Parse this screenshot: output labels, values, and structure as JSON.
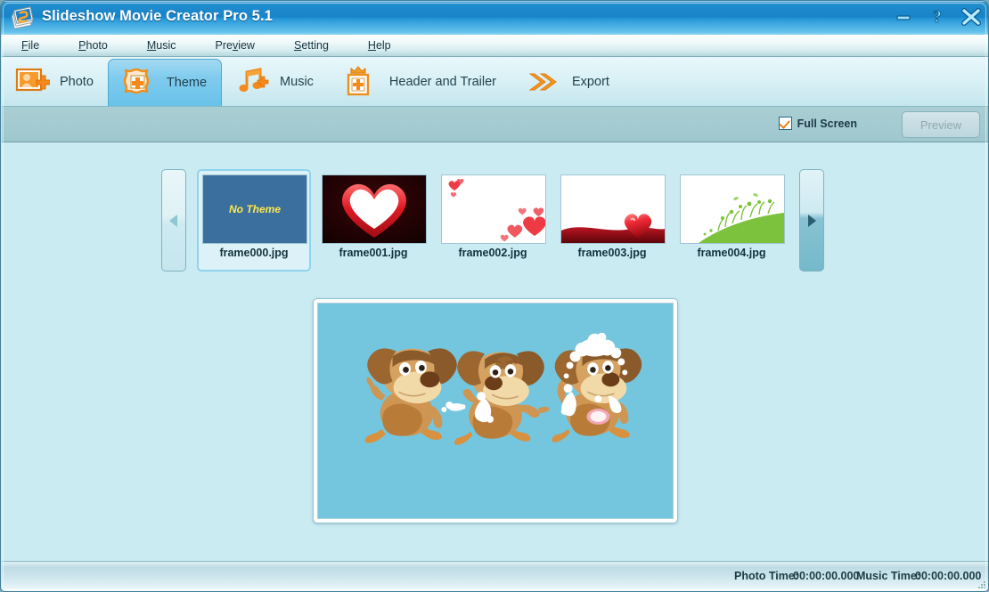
{
  "window": {
    "title": "Slideshow Movie Creator Pro 5.1",
    "app_icon": "slideshow-app-icon",
    "controls": [
      {
        "name": "minimize",
        "glyph": "minimize-icon"
      },
      {
        "name": "help",
        "glyph": "help-question-icon"
      },
      {
        "name": "close",
        "glyph": "close-x-icon"
      }
    ]
  },
  "menubar": {
    "items": [
      {
        "label": "File",
        "pre": "",
        "key": "F",
        "post": "ile"
      },
      {
        "label": "Photo",
        "pre": "",
        "key": "P",
        "post": "hoto"
      },
      {
        "label": "Music",
        "pre": "",
        "key": "M",
        "post": "usic"
      },
      {
        "label": "Preview",
        "pre": "Pre",
        "key": "v",
        "post": "iew"
      },
      {
        "label": "Setting",
        "pre": "",
        "key": "S",
        "post": "etting"
      },
      {
        "label": "Help",
        "pre": "",
        "key": "H",
        "post": "elp"
      }
    ]
  },
  "toolbar": {
    "items": [
      {
        "label": "Photo",
        "icon": "photo-add-icon",
        "selected": false
      },
      {
        "label": "Theme",
        "icon": "theme-frame-icon",
        "selected": true
      },
      {
        "label": "Music",
        "icon": "music-add-icon",
        "selected": false
      },
      {
        "label": "Header and Trailer",
        "icon": "header-crown-icon",
        "selected": false
      },
      {
        "label": "Export",
        "icon": "export-chevrons-icon",
        "selected": false
      }
    ]
  },
  "options": {
    "fullscreen_label": "Full Screen",
    "fullscreen_checked": true,
    "preview_button": "Preview",
    "preview_enabled": false
  },
  "themes": {
    "prev_arrow": "scroll-left-icon",
    "next_arrow": "scroll-right-icon",
    "selected_index": 0,
    "items": [
      {
        "caption": "frame000.jpg",
        "kind": "no-theme",
        "text": "No Theme"
      },
      {
        "caption": "frame001.jpg",
        "kind": "heart-outline"
      },
      {
        "caption": "frame002.jpg",
        "kind": "hearts-corner"
      },
      {
        "caption": "frame003.jpg",
        "kind": "heart-wave"
      },
      {
        "caption": "frame004.jpg",
        "kind": "green-grass"
      }
    ]
  },
  "preview": {
    "image_alt": "three-cartoon-dogs-bathing",
    "background_color": "#74c6de"
  },
  "statusbar": {
    "photo_time_label": "Photo Time:",
    "photo_time_value": "00:00:00.000",
    "music_time_label": "Music Time:",
    "music_time_value": "00:00:00.000"
  },
  "colors": {
    "title_blue": "#1884c9",
    "stage_cyan": "#cbebf3",
    "accent_orange": "#f08a1e",
    "selected_tab": "#7fcbee"
  }
}
